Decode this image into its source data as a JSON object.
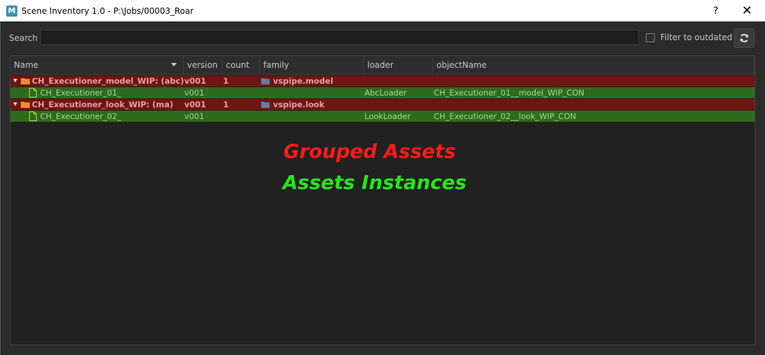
{
  "window": {
    "app_icon_letter": "M",
    "title": "Scene Inventory 1.0 - P:\\Jobs/00003_Roar",
    "help_label": "?",
    "close_label": "✕"
  },
  "toolbar": {
    "search_label": "Search",
    "search_value": "",
    "search_placeholder": "",
    "filter_label": "Filter to outdated",
    "filter_checked": false,
    "refresh_icon": "refresh-icon"
  },
  "tree": {
    "columns": [
      "Name",
      "version",
      "count",
      "family",
      "loader",
      "objectName"
    ],
    "rows": [
      {
        "type": "group",
        "name": "CH_Executioner_model_WIP: (abc)",
        "version": "v001",
        "count": "1",
        "family": "vspipe.model",
        "loader": "",
        "objectName": ""
      },
      {
        "type": "instance",
        "name": "CH_Executioner_01_",
        "version": "v001",
        "count": "",
        "family": "",
        "loader": "AbcLoader",
        "objectName": "CH_Executioner_01__model_WIP_CON"
      },
      {
        "type": "group",
        "name": "CH_Executioner_look_WIP: (ma)",
        "version": "v001",
        "count": "1",
        "family": "vspipe.look",
        "loader": "",
        "objectName": ""
      },
      {
        "type": "instance",
        "name": "CH_Executioner_02_",
        "version": "v001",
        "count": "",
        "family": "",
        "loader": "LookLoader",
        "objectName": "CH_Executioner_02__look_WIP_CON"
      }
    ]
  },
  "annotations": {
    "grouped": "Grouped Assets",
    "instances": "Assets Instances"
  },
  "colors": {
    "group_row": "#6e1515",
    "instance_row": "#2e6b1e",
    "annotation_red": "#ff1a1a",
    "annotation_green": "#26e61a"
  }
}
